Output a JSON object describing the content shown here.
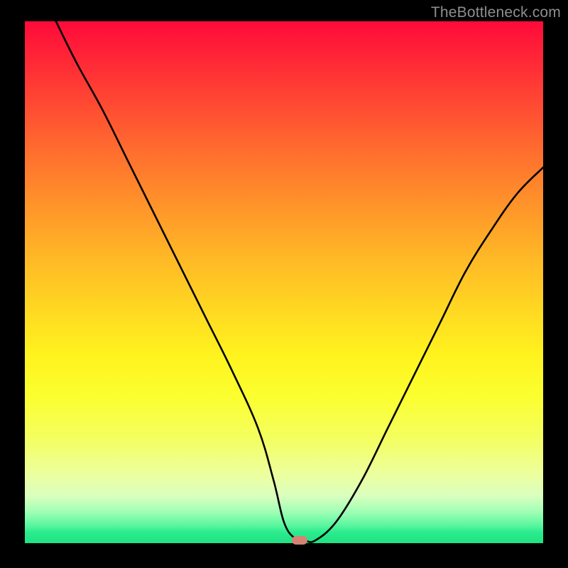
{
  "watermark": "TheBottleneck.com",
  "chart_data": {
    "type": "line",
    "title": "",
    "xlabel": "",
    "ylabel": "",
    "xlim": [
      0,
      100
    ],
    "ylim": [
      0,
      100
    ],
    "grid": false,
    "legend": false,
    "series": [
      {
        "name": "bottleneck-curve",
        "x": [
          6,
          10,
          15,
          20,
          25,
          30,
          35,
          40,
          45,
          48,
          50,
          52,
          54,
          56,
          60,
          65,
          70,
          75,
          80,
          85,
          90,
          95,
          100
        ],
        "y": [
          100,
          92,
          83,
          73,
          63,
          53,
          43,
          33,
          22,
          12,
          4,
          1,
          0.5,
          0.5,
          4,
          12,
          22,
          32,
          42,
          52,
          60,
          67,
          72
        ]
      }
    ],
    "min_marker": {
      "x": 53,
      "y": 0.5
    },
    "background_gradient": {
      "top": "#ff0a3a",
      "mid": "#fff31e",
      "bottom": "#1fe283"
    }
  }
}
